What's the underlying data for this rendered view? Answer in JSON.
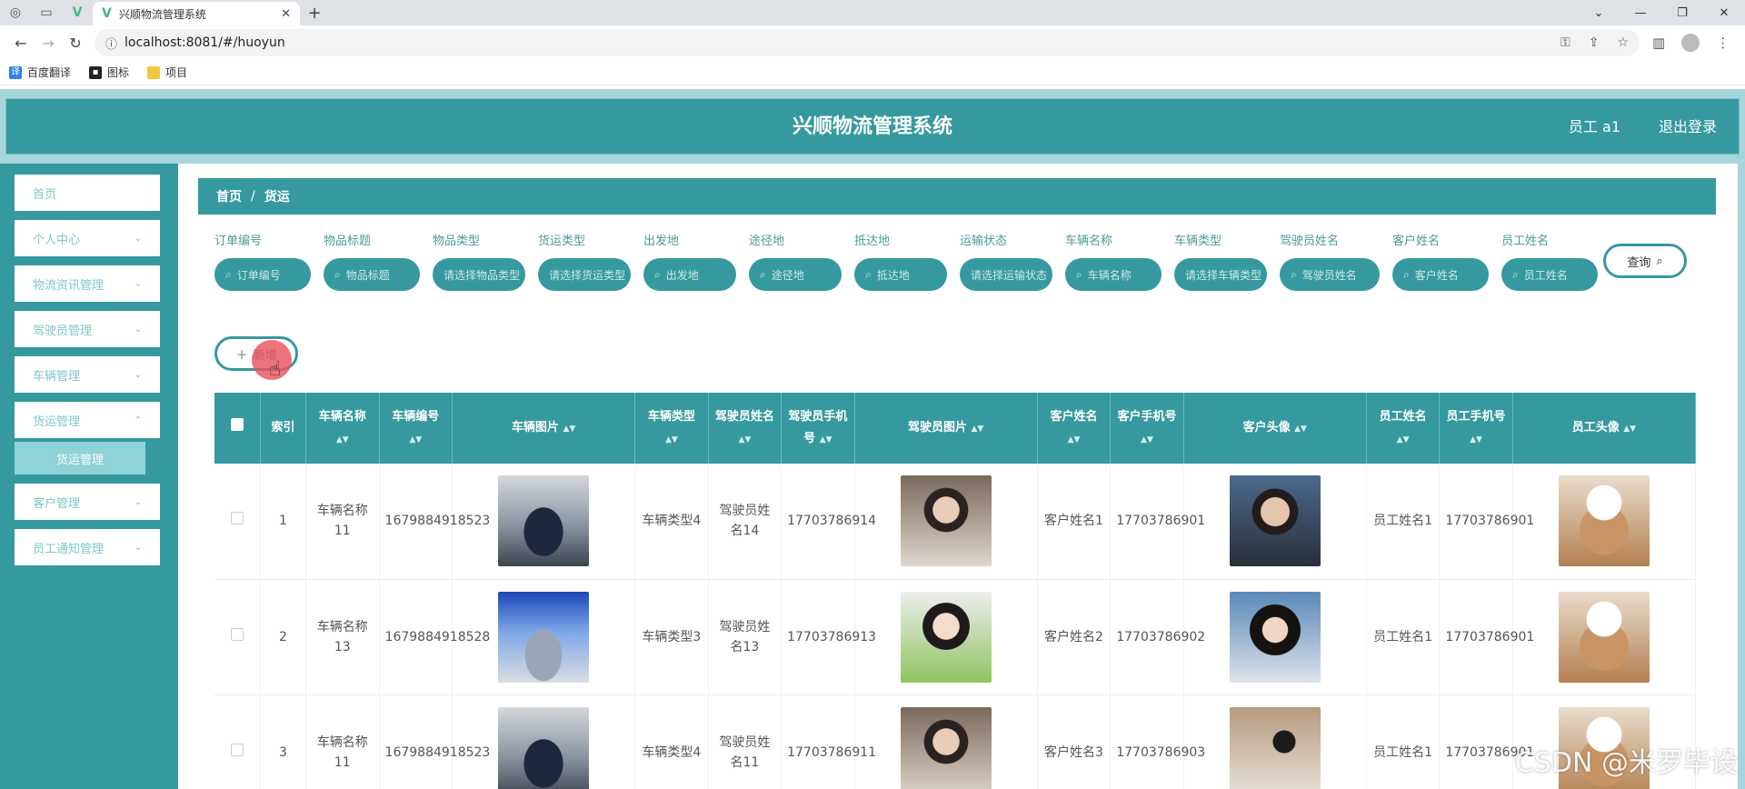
{
  "browser": {
    "tab_title": "兴顺物流管理系统",
    "url": "localhost:8081/#/huoyun",
    "bookmarks": [
      "百度翻译",
      "图标",
      "项目"
    ]
  },
  "header": {
    "title": "兴顺物流管理系统",
    "user": "员工 a1",
    "logout": "退出登录"
  },
  "sidebar": {
    "items": [
      {
        "label": "首页"
      },
      {
        "label": "个人中心"
      },
      {
        "label": "物流资讯管理"
      },
      {
        "label": "驾驶员管理"
      },
      {
        "label": "车辆管理"
      },
      {
        "label": "货运管理"
      },
      {
        "label": "客户管理"
      },
      {
        "label": "员工通知管理"
      }
    ],
    "submenu_active": "货运管理"
  },
  "breadcrumb": {
    "home": "首页",
    "sep": "/",
    "current": "货运"
  },
  "filters": [
    {
      "label": "订单编号",
      "placeholder": "订单编号"
    },
    {
      "label": "物品标题",
      "placeholder": "物品标题"
    },
    {
      "label": "物品类型",
      "placeholder": "请选择物品类型"
    },
    {
      "label": "货运类型",
      "placeholder": "请选择货运类型"
    },
    {
      "label": "出发地",
      "placeholder": "出发地"
    },
    {
      "label": "途径地",
      "placeholder": "途径地"
    },
    {
      "label": "抵达地",
      "placeholder": "抵达地"
    },
    {
      "label": "运输状态",
      "placeholder": "请选择运输状态"
    },
    {
      "label": "车辆名称",
      "placeholder": "车辆名称"
    },
    {
      "label": "车辆类型",
      "placeholder": "请选择车辆类型"
    },
    {
      "label": "驾驶员姓名",
      "placeholder": "驾驶员姓名"
    },
    {
      "label": "客户姓名",
      "placeholder": "客户姓名"
    },
    {
      "label": "员工姓名",
      "placeholder": "员工姓名"
    }
  ],
  "buttons": {
    "search": "查询",
    "add": "新增"
  },
  "table": {
    "headers": {
      "index": "索引",
      "vehicle_name": "车辆名称",
      "vehicle_no": "车辆编号",
      "vehicle_photo": "车辆图片",
      "vehicle_type": "车辆类型",
      "driver_name": "驾驶员姓名",
      "driver_phone": "驾驶员手机号",
      "driver_photo": "驾驶员图片",
      "customer_name": "客户姓名",
      "customer_phone": "客户手机号",
      "customer_avatar": "客户头像",
      "staff_name": "员工姓名",
      "staff_phone": "员工手机号",
      "staff_avatar": "员工头像"
    },
    "rows": [
      {
        "index": "1",
        "vehicle_name": "车辆名称11",
        "vehicle_no": "1679884918523",
        "vehicle_type": "车辆类型4",
        "driver_name": "驾驶员姓名14",
        "driver_phone": "17703786914",
        "customer_name": "客户姓名1",
        "customer_phone": "17703786901",
        "staff_name": "员工姓名1",
        "staff_phone": "17703786901"
      },
      {
        "index": "2",
        "vehicle_name": "车辆名称13",
        "vehicle_no": "1679884918528",
        "vehicle_type": "车辆类型3",
        "driver_name": "驾驶员姓名13",
        "driver_phone": "17703786913",
        "customer_name": "客户姓名2",
        "customer_phone": "17703786902",
        "staff_name": "员工姓名1",
        "staff_phone": "17703786901"
      },
      {
        "index": "3",
        "vehicle_name": "车辆名称11",
        "vehicle_no": "1679884918523",
        "vehicle_type": "车辆类型4",
        "driver_name": "驾驶员姓名11",
        "driver_phone": "17703786911",
        "customer_name": "客户姓名3",
        "customer_phone": "17703786903",
        "staff_name": "员工姓名1",
        "staff_phone": "17703786901"
      }
    ]
  },
  "watermark": "CSDN @米罗毕设",
  "colors": {
    "primary": "#35999f",
    "app_bg": "#a6d5dc",
    "submenu": "#8fd2d8"
  }
}
